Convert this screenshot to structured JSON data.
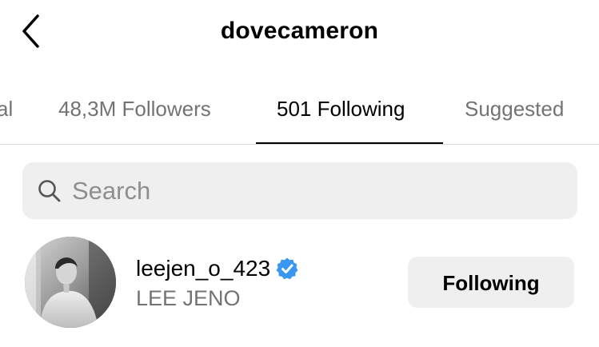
{
  "header": {
    "back_icon": "chevron-left-icon",
    "title": "dovecameron"
  },
  "tabs": [
    {
      "label": "al",
      "active": false
    },
    {
      "label": "48,3M Followers",
      "active": false
    },
    {
      "label": "501 Following",
      "active": true
    },
    {
      "label": "Suggested",
      "active": false
    }
  ],
  "search": {
    "placeholder": "Search",
    "value": "",
    "icon": "search-icon"
  },
  "list": [
    {
      "username": "leejen_o_423",
      "verified": true,
      "full_name": "LEE JENO",
      "button_label": "Following"
    }
  ],
  "colors": {
    "verified_badge": "#3897f0",
    "secondary_text": "#737373",
    "button_bg": "#efefef",
    "divider": "#dbdbdb"
  }
}
